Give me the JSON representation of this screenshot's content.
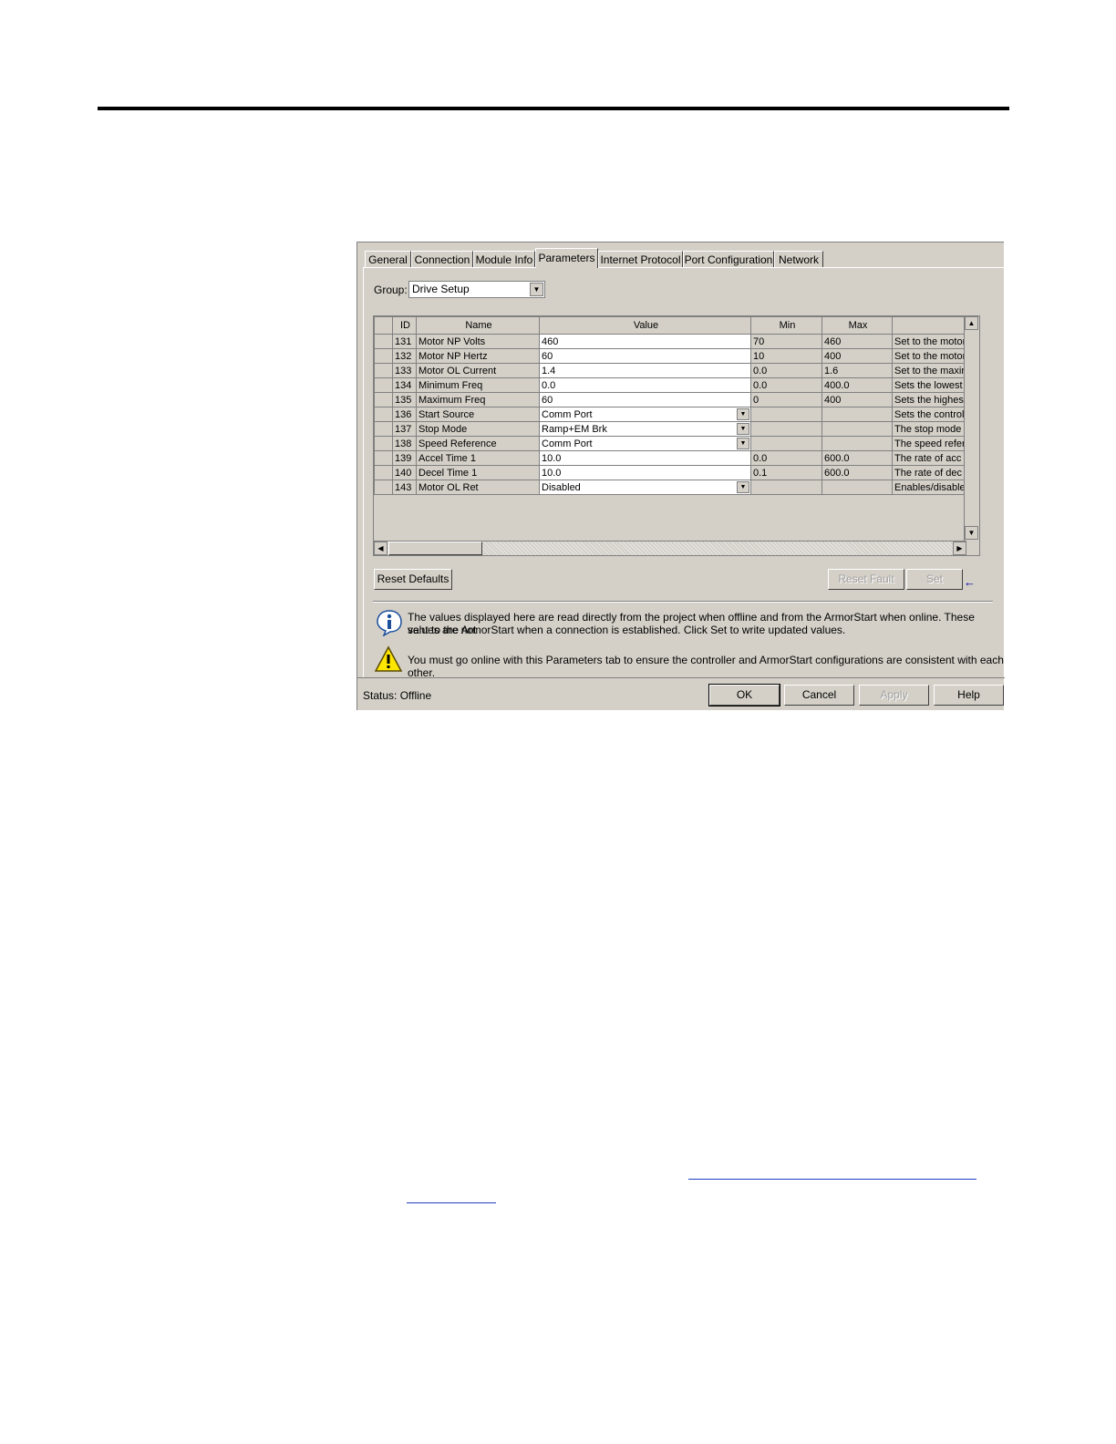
{
  "dialog": {
    "tabs": [
      {
        "label": "General"
      },
      {
        "label": "Connection"
      },
      {
        "label": "Module Info"
      },
      {
        "label": "Parameters"
      },
      {
        "label": "Internet Protocol"
      },
      {
        "label": "Port Configuration"
      },
      {
        "label": "Network"
      }
    ],
    "active_tab": "Parameters",
    "group": {
      "label": "Group:",
      "value": "Drive Setup"
    },
    "table": {
      "columns": [
        "ID",
        "Name",
        "Value",
        "Min",
        "Max",
        ""
      ],
      "rows": [
        {
          "id": "131",
          "name": "Motor NP Volts",
          "value": "460",
          "min": "70",
          "max": "460",
          "desc": "Set to the motor",
          "dropdown": false
        },
        {
          "id": "132",
          "name": "Motor NP Hertz",
          "value": "60",
          "min": "10",
          "max": "400",
          "desc": "Set to the motor",
          "dropdown": false
        },
        {
          "id": "133",
          "name": "Motor OL Current",
          "value": "1.4",
          "min": "0.0",
          "max": "1.6",
          "desc": "Set to the maxin",
          "dropdown": false
        },
        {
          "id": "134",
          "name": "Minimum Freq",
          "value": "0.0",
          "min": "0.0",
          "max": "400.0",
          "desc": "Sets the lowest",
          "dropdown": false
        },
        {
          "id": "135",
          "name": "Maximum Freq",
          "value": "60",
          "min": "0",
          "max": "400",
          "desc": "Sets the highes",
          "dropdown": false
        },
        {
          "id": "136",
          "name": "Start Source",
          "value": "Comm Port",
          "min": "",
          "max": "",
          "desc": "Sets the control",
          "dropdown": true
        },
        {
          "id": "137",
          "name": "Stop Mode",
          "value": "Ramp+EM Brk",
          "min": "",
          "max": "",
          "desc": "The stop mode",
          "dropdown": true
        },
        {
          "id": "138",
          "name": "Speed Reference",
          "value": "Comm Port",
          "min": "",
          "max": "",
          "desc": "The speed refer",
          "dropdown": true
        },
        {
          "id": "139",
          "name": "Accel Time 1",
          "value": "10.0",
          "min": "0.0",
          "max": "600.0",
          "desc": "The rate of acc",
          "dropdown": false
        },
        {
          "id": "140",
          "name": "Decel Time 1",
          "value": "10.0",
          "min": "0.1",
          "max": "600.0",
          "desc": "The rate of dec",
          "dropdown": false
        },
        {
          "id": "143",
          "name": "Motor OL Ret",
          "value": "Disabled",
          "min": "",
          "max": "",
          "desc": "Enables/disable",
          "dropdown": true
        }
      ]
    },
    "buttons": {
      "reset_defaults": "Reset Defaults",
      "reset_fault": "Reset Fault",
      "set": "Set",
      "ok": "OK",
      "cancel": "Cancel",
      "apply": "Apply",
      "help": "Help"
    },
    "info_message_1": "The values displayed here are read directly from the project when offline and from the ArmorStart when online. These values are not",
    "info_message_2": "sent to the ArmorStart when a connection is established.  Click Set to write updated values.",
    "warning_message": "You must go online with this Parameters tab to ensure the controller and ArmorStart configurations are consistent with each other.",
    "status": "Status:  Offline",
    "icons": [
      "info-icon",
      "warning-icon",
      "dropdown-arrow-icon",
      "scroll-up-icon",
      "scroll-down-icon",
      "scroll-left-icon",
      "scroll-right-icon",
      "left-arrow-icon"
    ]
  }
}
